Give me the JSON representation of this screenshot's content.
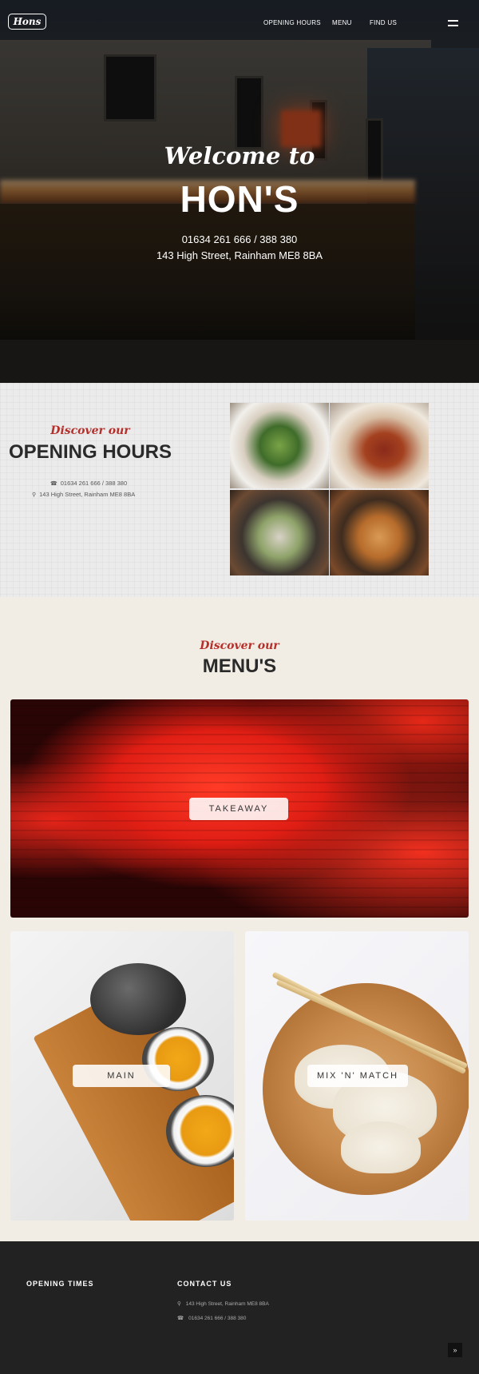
{
  "header": {
    "logo": "Hons",
    "nav": [
      "OPENING HOURS",
      "MENU",
      "FIND US"
    ]
  },
  "hero": {
    "welcome": "Welcome to",
    "title": "HON'S",
    "phone": "01634 261 666 / 388 380",
    "address": "143 High Street, Rainham ME8 8BA"
  },
  "hours": {
    "eyebrow": "Discover our",
    "title": "OPENING HOURS",
    "phone": "01634 261 666 / 388 380",
    "address": "143 High Street, Rainham ME8 8BA"
  },
  "menus": {
    "eyebrow": "Discover our",
    "title": "MENU'S",
    "cards": [
      "TAKEAWAY",
      "MAIN",
      "MIX 'N' MATCH"
    ]
  },
  "footer": {
    "opening_heading": "OPENING TIMES",
    "contact_heading": "CONTACT US",
    "address": "143 High Street, Rainham ME8 8BA",
    "phone": "01634 261 666 / 388 380"
  },
  "icons": {
    "phone": "phone-icon",
    "location": "map-marker-icon",
    "menu": "hamburger-icon",
    "top": "chevron-up-icon"
  }
}
